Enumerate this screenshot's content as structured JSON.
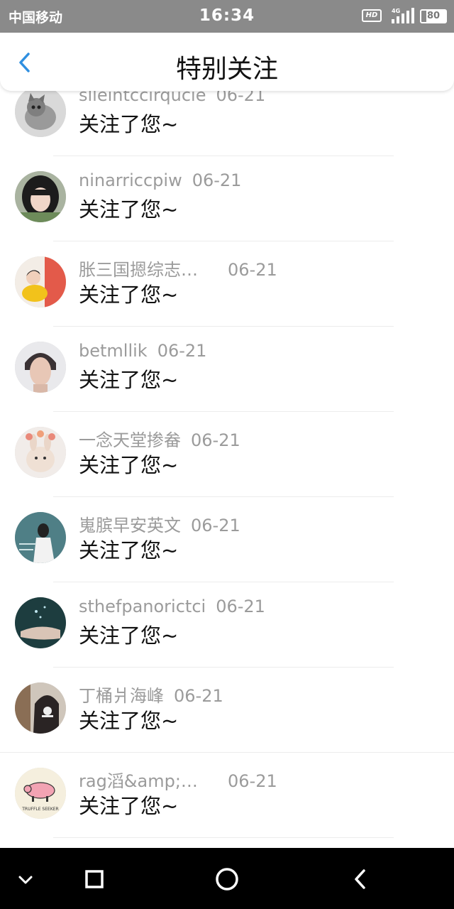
{
  "status_bar": {
    "carrier": "中国移动",
    "time": "16:34",
    "hd_label": "HD",
    "network": "4G",
    "battery": "80",
    "battery_level": 0.8,
    "icons": [
      "hd-icon",
      "signal-icon",
      "battery-icon"
    ]
  },
  "header": {
    "title": "特别关注",
    "back_icon": "chevron-left-icon"
  },
  "feed": {
    "items": [
      {
        "username": "slleintccirqucie",
        "date": "06-21",
        "message": "关注了您~"
      },
      {
        "username": "ninarriccpiw",
        "date": "06-21",
        "message": "关注了您~"
      },
      {
        "username": "胀三国摁综志…",
        "date": "06-21",
        "message": "关注了您~"
      },
      {
        "username": "betmllik",
        "date": "06-21",
        "message": "关注了您~"
      },
      {
        "username": "一念天堂掺畚",
        "date": "06-21",
        "message": "关注了您~"
      },
      {
        "username": "嵬膑早安英文",
        "date": "06-21",
        "message": "关注了您~"
      },
      {
        "username": "sthefpanorictci",
        "date": "06-21",
        "message": "关注了您~"
      },
      {
        "username": "丁桶爿海峰",
        "date": "06-21",
        "message": "关注了您~"
      },
      {
        "username": "rag滔&amp;…",
        "date": "06-21",
        "message": "关注了您~"
      }
    ],
    "avatar_texts": {
      "item_9": "TRUFFLE SEEKER"
    }
  },
  "system_nav": {
    "buttons": [
      "hide-keyboard-icon",
      "recents-icon",
      "home-icon",
      "back-icon"
    ]
  },
  "colors": {
    "status_bar_bg": "#8a8a8a",
    "accent_blue": "#2f8fe0",
    "username_gray": "#9b9b9b",
    "message_black": "#111111",
    "divider": "#ececec",
    "nav_bg": "#000000"
  }
}
